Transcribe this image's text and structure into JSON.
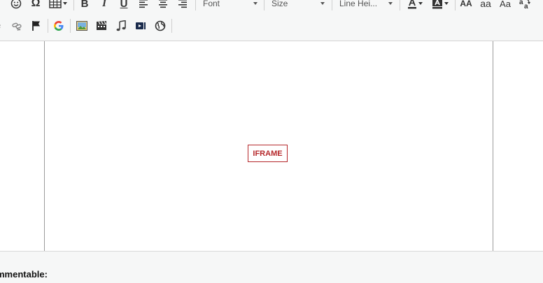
{
  "toolbar": {
    "font_label": "Font",
    "size_label": "Size",
    "line_height_label": "Line Hei...",
    "omega_label": "Ω",
    "bold_label": "B",
    "italic_label": "I",
    "underline_label": "U",
    "case_upper_label": "AA",
    "case_lower_label": "aa",
    "case_title_label": "Aa",
    "icons": [
      "emoticon-icon",
      "omega-icon",
      "table-icon",
      "bold-icon",
      "italic-icon",
      "underline-icon",
      "align-left-icon",
      "align-center-icon",
      "align-right-icon",
      "text-color-icon",
      "background-color-icon",
      "uppercase-icon",
      "lowercase-icon",
      "titlecase-icon",
      "change-case-icon",
      "link-icon",
      "unlink-icon",
      "anchor-flag-icon",
      "google-icon",
      "image-icon",
      "video-icon",
      "audio-icon",
      "youtube-icon",
      "globe-icon"
    ]
  },
  "editor": {
    "iframe_placeholder": "IFRAME"
  },
  "footer": {
    "label": "mmentable:"
  },
  "colors": {
    "accent_red": "#b5272a",
    "toolbar_bg": "#f6f7f7"
  }
}
